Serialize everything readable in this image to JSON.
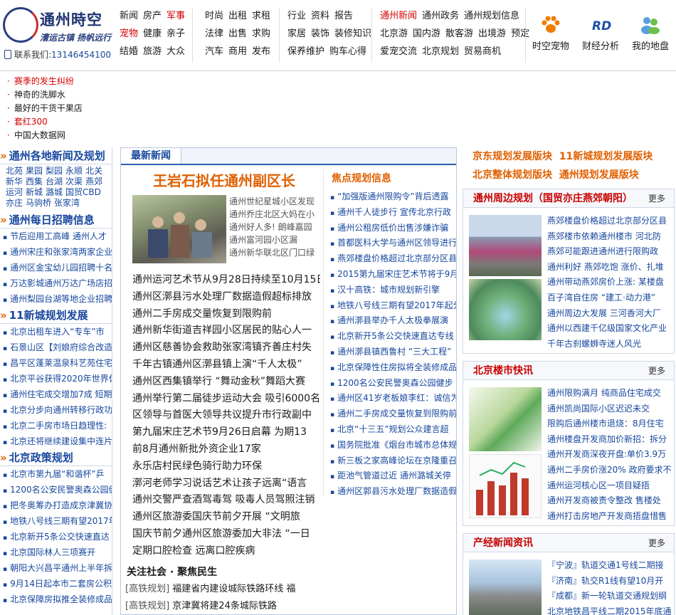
{
  "header": {
    "logo_title": "通州時空",
    "logo_slogan": "漕运古镇 扬帆远行",
    "contact_label": "联系我们:",
    "contact_phone": "13146454100",
    "nav_groups": [
      {
        "rows": [
          [
            {
              "t": "新闻"
            },
            {
              "t": "房产"
            },
            {
              "t": "军事",
              "red": true
            }
          ],
          [
            {
              "t": "宠物",
              "red": true
            },
            {
              "t": "健康"
            },
            {
              "t": "亲子"
            }
          ],
          [
            {
              "t": "结婚"
            },
            {
              "t": "旅游"
            },
            {
              "t": "大众"
            }
          ]
        ]
      },
      {
        "rows": [
          [
            {
              "t": "时尚"
            },
            {
              "t": "出租"
            },
            {
              "t": "求租"
            }
          ],
          [
            {
              "t": "法律"
            },
            {
              "t": "出售"
            },
            {
              "t": "求购"
            }
          ],
          [
            {
              "t": "汽车"
            },
            {
              "t": "商用"
            },
            {
              "t": "发布"
            }
          ]
        ]
      },
      {
        "rows": [
          [
            {
              "t": "行业"
            },
            {
              "t": "资料"
            },
            {
              "t": "报告"
            }
          ],
          [
            {
              "t": "家居"
            },
            {
              "t": "装饰"
            },
            {
              "t": "装修知识"
            }
          ],
          [
            {
              "t": "保养维护"
            },
            {
              "t": "购车心得"
            }
          ]
        ]
      },
      {
        "rows": [
          [
            {
              "t": "通州新闻",
              "red": true
            },
            {
              "t": "通州政务"
            },
            {
              "t": "通州规划信息"
            }
          ],
          [
            {
              "t": "北京游"
            },
            {
              "t": "国内游"
            },
            {
              "t": "散客游"
            },
            {
              "t": "出境游"
            },
            {
              "t": "预定"
            }
          ],
          [
            {
              "t": "爱宠交流"
            },
            {
              "t": "北京规划"
            },
            {
              "t": "贸易商机"
            }
          ]
        ]
      }
    ],
    "icons": [
      {
        "label": "时空宠物",
        "icon": "paw-icon"
      },
      {
        "label": "财经分析",
        "icon": "rd-icon"
      },
      {
        "label": "我的地盘",
        "icon": "people-icon"
      }
    ]
  },
  "top_links": [
    {
      "t": "赛季的发生纠纷",
      "red": true
    },
    {
      "t": "神奇的洗脚水"
    },
    {
      "t": "最好的干货干果店"
    },
    {
      "t": "套红300",
      "red": true
    },
    {
      "t": "中国大数据网"
    }
  ],
  "left": {
    "sec1_title": "通州各地新闻及规划",
    "cities": [
      "北苑",
      "果园",
      "梨园",
      "永顺",
      "北关",
      "新华",
      "西集",
      "台湖",
      "次渠",
      "燕郊",
      "运河",
      "新城",
      "潞城",
      "国贸CBD",
      "亦庄",
      "马驹桥",
      "张家湾"
    ],
    "sec2_title": "通州每日招聘信息",
    "jobs": [
      "节后迎用工高峰 通州人才",
      "通州宋庄和张家湾两家企业",
      "通州区金宝幼儿园招聘十名",
      "万达影城通州万达广场店招",
      "通州梨园台湖等地企业招聘"
    ],
    "sec3_title": "11新城规划发展",
    "plans": [
      "北京出租车进入“专车”市",
      "石景山区【刘娘府综合改造",
      "昌平区蓬莱温泉科艺苑住宅",
      "北京平谷获得2020年世界休",
      "通州住宅成交增加7成 短期",
      "北京分步向通州转移行政功",
      "北京二手房市场日趋理性:",
      "北京还将继续建设集中连片"
    ],
    "sec4_title": "北京政策规划",
    "policies": [
      "北京市第九届“和谐杯”乒",
      "1200名公安民警奥森公园健",
      "把冬奥筹办打造成京津冀协",
      "地铁八号线三期有望2017年",
      "北京新开5条公交快速直达",
      "北京国际林人三项赛开",
      "朝阳大兴昌平通州上半年拆",
      "9月14日起本市二套房公积",
      "北京保障房拟推全装修成品"
    ]
  },
  "center": {
    "tab_title": "最新新闻",
    "headline": "王岩石拟任通州副区长",
    "side_items": [
      "通州世纪星城小区发现",
      "通州乔庄北区大妈在小",
      "通州好人多! 朗峰嘉园",
      "通州富河园小区漏",
      "通州新华联北区门口绿"
    ],
    "news": [
      "通州运河艺术节从9月28日持续至10月15日",
      "通州区漷县污水处理厂数据造假超标排放",
      "通州二手房成交量恢复到限购前",
      "通州新华街道吉祥园小区居民的贴心人一",
      "通州区慈善协会救助张家湾镇齐善庄村失",
      "千年古镇通州区漷县镇上演“千人太极”",
      "通州区西集镇举行 “舞动金秋”舞蹈大赛",
      "通州举行第二届徒步运动大会 吸引6000名",
      "区领导与首医大领导共议提升市行政副中",
      "第九届宋庄艺术节9月26日启幕 为期13",
      "前8月通州新批外资企业17家",
      "永乐店村民绿色骑行助力环保",
      "漷河老师学习说话艺术让孩子远离“语言",
      "通州交警严查酒驾毒驾 吸毒人员驾照注销",
      "通州区旅游委国庆节前夕开展 “文明旅",
      "国庆节前夕通州区旅游委加大非法 “一日",
      "定期口腔检查 远离口腔疾病"
    ],
    "focus_title": "关注社会 · 聚焦民生",
    "focus": [
      {
        "tag": "[高铁规划]",
        "t": "福建省内建设城际铁路环线 福"
      },
      {
        "tag": "[高铁规划]",
        "t": "京津冀将建24条城际铁路"
      }
    ],
    "jd_title": "焦点规划信息",
    "jd": [
      "“加强版通州限购令”背后透露",
      "通州千人徒步行 宣传北京行政",
      "通州公租房低价出售涉嫌诈骗",
      "首都医科大学与通州区领导进行",
      "燕郊楼盘价格超过北京部分区县",
      "2015第九届宋庄艺术节将于9月",
      "汉十高铁：城市规划新引擎",
      "地铁八号线三期有望2017年起分",
      "通州漷县举办千人太极拳展演",
      "北京新开5条公交快速直达专线",
      "通州漷县镇西鲁村 “三大工程”",
      "北京保障性住房拟将全装修成品",
      "1200名公安民警奥森公园健步",
      "通州区41岁老板娘李红：诚信为",
      "通州二手房成交量恢复到限购前",
      "北京“十三五”规划公众建言超",
      "国务院批准《烟台市城市总体规",
      "新三板之家高峰论坛在京隆重召",
      "距池气管道过近 通州潞城关停",
      "通州区郭县污水处理厂数据造假"
    ]
  },
  "right": {
    "banner1": [
      "京东规划发展版块",
      "11新城规划发展版块"
    ],
    "banner2": [
      "北京整体规划版块",
      "通州规划发展版块"
    ],
    "box1": {
      "title": "通州周边规划（国贸亦庄燕郊朝阳）",
      "more": "更多",
      "items": [
        "燕郊楼盘价格超过北京部分区县",
        "燕郊楼市依赖通州楼市 河北防",
        "燕郊可能跟进通州进行限购政",
        "通州利好 燕郊吃饱 涨价、扎堆",
        "通州带动燕郊房价上涨: 某楼盘",
        "百子湾自住房 “建工·动力港”",
        "通州周边大发展 三河香河大厂",
        "通州以西建千亿级国家文化产业",
        "千年古刹螺蛳寺迷人风光"
      ]
    },
    "box2": {
      "title": "北京楼市快讯",
      "more": "更多",
      "items": [
        "通州限购满月 纯商品住宅成交",
        "通州凯尚国际小区迟迟未交",
        "限购后通州楼市退烧：8月住宅",
        "通州楼盘开发商加价新招：拆分",
        "通州开发商深夜开盘:单价3.9万",
        "通州二手房价涨20% 政府要求不",
        "通州运河核心区一项目疑捂",
        "通州开发商被责令整改 售楼处",
        "通州打击房地产开发商捂盘惜售"
      ]
    },
    "box3": {
      "title": "产经新闻资讯",
      "more": "更多",
      "items": [
        "『宁波』轨道交通1号线二期接",
        "『济南』轨交R1线有望10月开",
        "『成都』新一轮轨道交通规划纲",
        "北京地铁昌平线二期2015年底通"
      ]
    }
  }
}
